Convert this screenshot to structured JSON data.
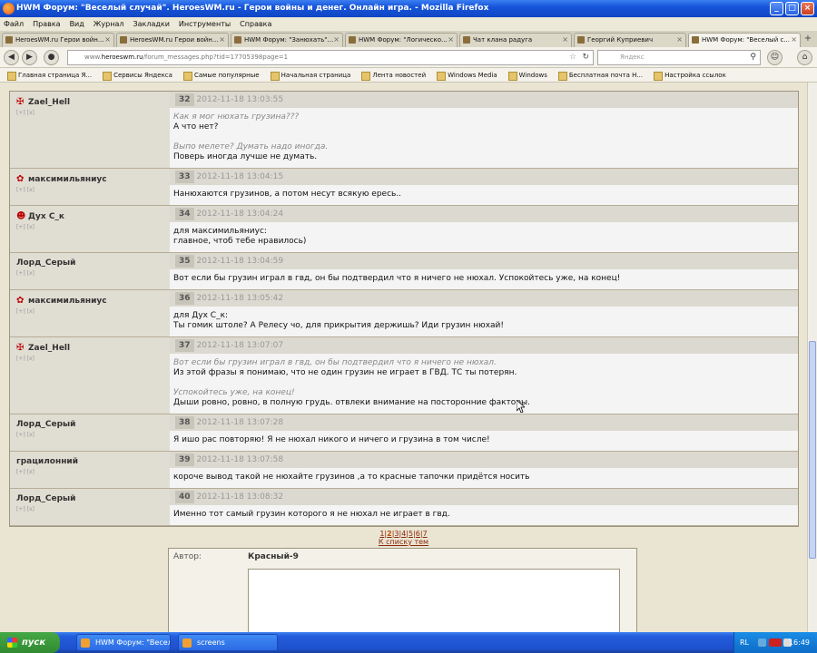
{
  "window": {
    "title": "HWM Форум: \"Веселый случай\". HeroesWM.ru - Герои войны и денег. Онлайн игра. - Mozilla Firefox"
  },
  "menu": [
    "Файл",
    "Правка",
    "Вид",
    "Журнал",
    "Закладки",
    "Инструменты",
    "Справка"
  ],
  "tabs": [
    {
      "label": "HeroesWM.ru Герои войн..."
    },
    {
      "label": "HeroesWM.ru Герои войн..."
    },
    {
      "label": "HWM Форум: \"Занюхать\"..."
    },
    {
      "label": "HWM Форум: \"Логическо..."
    },
    {
      "label": "Чат клана радуга"
    },
    {
      "label": "Георгий Куприевич"
    },
    {
      "label": "HWM Форум: \"Веселый с..."
    }
  ],
  "url": {
    "prefix": "www.",
    "host": "heroeswm.ru",
    "path": "/forum_messages.php?tid=17705398page=1"
  },
  "search": {
    "placeholder": "Яндекс"
  },
  "bookmarks": [
    "Главная страница Я...",
    "Сервисы Яндекса",
    "Самые популярные",
    "Начальная страница",
    "Лента новостей",
    "Windows Media",
    "Windows",
    "Бесплатная почта Н...",
    "Настройка ссылок"
  ],
  "posts": [
    {
      "author": "Zael_Hell",
      "badge": "cross",
      "num": "32",
      "date": "2012-11-18 13:03:55",
      "lines": [
        {
          "t": "Как я мог нюхать грузина???",
          "q": true
        },
        {
          "t": "А что нет?",
          "q": false
        },
        {
          "t": "",
          "q": false
        },
        {
          "t": "Выпо мелете? Думать надо иногда.",
          "q": true
        },
        {
          "t": "Поверь иногда лучше не думать.",
          "q": false
        }
      ]
    },
    {
      "author": "максимильяниус",
      "badge": "leaf",
      "num": "33",
      "date": "2012-11-18 13:04:15",
      "lines": [
        {
          "t": "Нанюхаются грузинов, а потом несут всякую ересь..",
          "q": false
        }
      ]
    },
    {
      "author": "Дух С_к",
      "badge": "panda",
      "num": "34",
      "date": "2012-11-18 13:04:24",
      "lines": [
        {
          "t": "для максимильяниус:",
          "q": false
        },
        {
          "t": "главное, чтоб тебе нравилось)",
          "q": false
        }
      ]
    },
    {
      "author": "Лорд_Серый",
      "badge": "",
      "num": "35",
      "date": "2012-11-18 13:04:59",
      "lines": [
        {
          "t": "Вот если бы грузин играл в гвд, он бы подтвердил что я ничего не нюхал. Успокойтесь уже, на конец!",
          "q": false
        }
      ]
    },
    {
      "author": "максимильяниус",
      "badge": "leaf",
      "num": "36",
      "date": "2012-11-18 13:05:42",
      "lines": [
        {
          "t": "для Дух С_к:",
          "q": false
        },
        {
          "t": "Ты гомик штоле? А Релесу чо, для прикрытия держишь? Иди грузин нюхай!",
          "q": false
        }
      ]
    },
    {
      "author": "Zael_Hell",
      "badge": "cross",
      "num": "37",
      "date": "2012-11-18 13:07:07",
      "lines": [
        {
          "t": "Вот если бы грузин играл в гвд, он бы подтвердил что я ничего не нюхал.",
          "q": true
        },
        {
          "t": "Из этой фразы я понимаю, что не один грузин не играет в ГВД. ТС ты потерян.",
          "q": false
        },
        {
          "t": "",
          "q": false
        },
        {
          "t": "Успокойтесь уже, на конец!",
          "q": true
        },
        {
          "t": "Дыши ровно, ровно, в полную грудь. отвлеки внимание на посторонние факторы.",
          "q": false
        }
      ]
    },
    {
      "author": "Лорд_Серый",
      "badge": "",
      "num": "38",
      "date": "2012-11-18 13:07:28",
      "lines": [
        {
          "t": "Я ишо рас повторяю! Я не нюхал никого и ничего и грузина в том числе!",
          "q": false
        }
      ]
    },
    {
      "author": "грацилонний",
      "badge": "",
      "num": "39",
      "date": "2012-11-18 13:07:58",
      "lines": [
        {
          "t": "короче вывод такой не нюхайте грузинов ,а то красные тапочки придётся носить",
          "q": false
        }
      ]
    },
    {
      "author": "Лорд_Серый",
      "badge": "",
      "num": "40",
      "date": "2012-11-18 13:08:32",
      "lines": [
        {
          "t": "Именно тот самый грузин которого я не нюхал не играет в гвд.",
          "q": false
        }
      ]
    }
  ],
  "author_small": "[+] [x]",
  "pager": {
    "pages": [
      "1",
      "2",
      "3",
      "4",
      "5",
      "6",
      "7"
    ],
    "current": "2",
    "back": "К списку тем"
  },
  "reply": {
    "label": "Автор:",
    "author": "Красный-9"
  },
  "taskbar": {
    "start": "пуск",
    "tasks": [
      "HWM Форум: \"Весел...",
      "screens"
    ],
    "lang": "RL",
    "clock": "16:49"
  },
  "colors": {
    "accent": "#0f46c4",
    "forum_bg": "#eae4d3",
    "header": "#dcd9d0"
  }
}
